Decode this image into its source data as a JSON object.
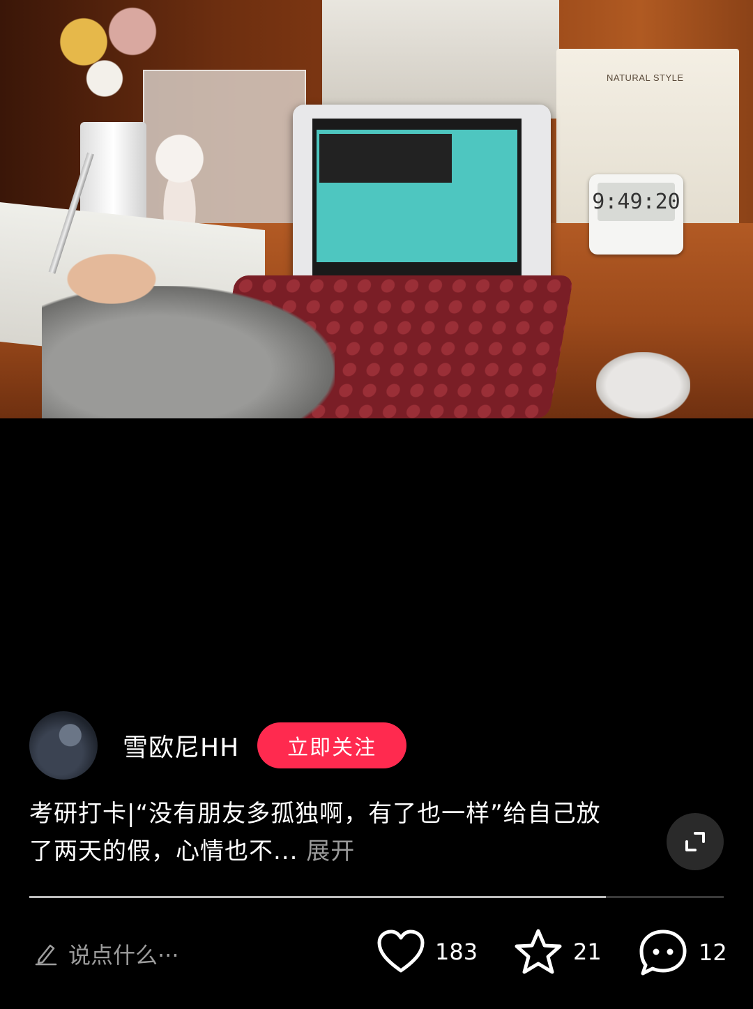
{
  "post": {
    "author_name": "雪欧尼HH",
    "follow_label": "立即关注",
    "caption_text": "考研打卡|“没有朋友多孤独啊，有了也一样”给自己放了两天的假，心情也不...",
    "expand_label": "展开"
  },
  "photo": {
    "cabinet_label": "NATURAL STYLE",
    "timer_display": "9:49:20"
  },
  "playback": {
    "progress": 0.83
  },
  "bottom_bar": {
    "comment_placeholder": "说点什么···",
    "like_count": "183",
    "favorite_count": "21",
    "comment_count": "12"
  },
  "colors": {
    "follow_button": "#ff2a4f",
    "background": "#000000",
    "muted_text": "#9a9a9a"
  },
  "icons": {
    "comment_input": "pencil-icon",
    "like": "heart-icon",
    "favorite": "star-icon",
    "comment": "speech-bubble-icon",
    "expand": "fullscreen-icon"
  }
}
